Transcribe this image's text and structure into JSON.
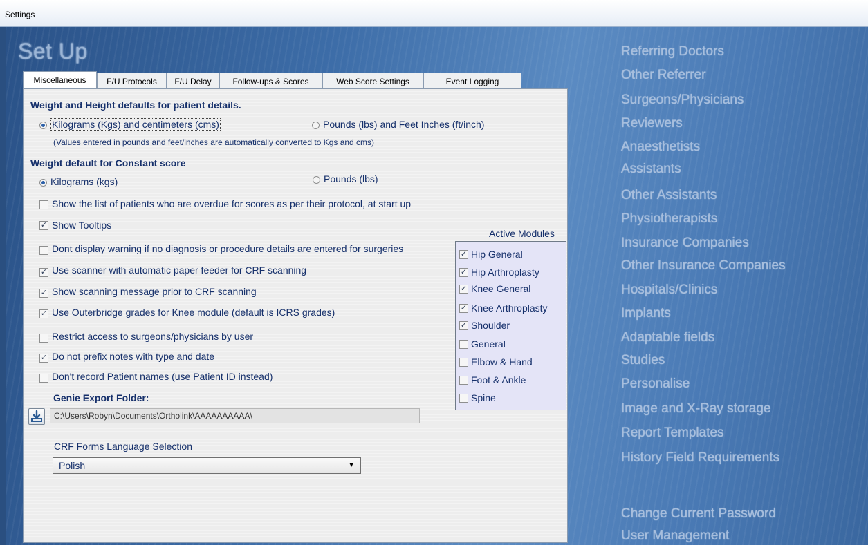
{
  "window": {
    "title": "Settings"
  },
  "page_title": "Set Up",
  "tabs": [
    {
      "label": "Miscellaneous",
      "active": true
    },
    {
      "label": "F/U Protocols"
    },
    {
      "label": "F/U Delay"
    },
    {
      "label": "Follow-ups & Scores"
    },
    {
      "label": "Web Score Settings"
    },
    {
      "label": "Event Logging"
    }
  ],
  "misc": {
    "weight_height_heading": "Weight and Height defaults for patient details.",
    "wh_option_metric": "Kilograms (Kgs)  and  centimeters (cms)",
    "wh_option_imperial": "Pounds (lbs)  and  Feet Inches (ft/inch)",
    "wh_note": "(Values entered in pounds and feet/inches are automatically converted to Kgs and cms)",
    "constant_heading": "Weight default for Constant score",
    "constant_option_kg": "Kilograms (kgs)",
    "constant_option_lbs": "Pounds (lbs)",
    "options": [
      {
        "label": "Show the list of patients who are overdue for scores as per their protocol, at start up",
        "checked": false
      },
      {
        "label": "Show Tooltips",
        "checked": true
      },
      {
        "label": "Dont display warning if no diagnosis or procedure details are entered for surgeries",
        "checked": false
      },
      {
        "label": "Use scanner with automatic paper feeder for CRF scanning",
        "checked": true
      },
      {
        "label": "Show scanning message prior to CRF scanning",
        "checked": true
      },
      {
        "label": "Use Outerbridge grades for Knee module (default is ICRS grades)",
        "checked": true
      },
      {
        "label": "Restrict access to surgeons/physicians by user",
        "checked": false
      },
      {
        "label": "Do not prefix notes with type and date",
        "checked": true
      },
      {
        "label": "Don't record Patient names (use Patient ID instead)",
        "checked": false
      }
    ],
    "genie_label": "Genie Export Folder:",
    "genie_path": "C:\\Users\\Robyn\\Documents\\Ortholink\\AAAAAAAAAA\\",
    "crf_label": "CRF Forms Language Selection",
    "crf_value": "Polish"
  },
  "active_modules": {
    "title": "Active Modules",
    "items": [
      {
        "label": "Hip General",
        "checked": true
      },
      {
        "label": "Hip Arthroplasty",
        "checked": true
      },
      {
        "label": "Knee General",
        "checked": true
      },
      {
        "label": "Knee Arthroplasty",
        "checked": true
      },
      {
        "label": "Shoulder",
        "checked": true
      },
      {
        "label": "General",
        "checked": false
      },
      {
        "label": "Elbow & Hand",
        "checked": false
      },
      {
        "label": "Foot & Ankle",
        "checked": false
      },
      {
        "label": "Spine",
        "checked": false
      }
    ]
  },
  "sidebar": {
    "links": [
      "Referring Doctors",
      "Other Referrer",
      "Surgeons/Physicians",
      "Reviewers",
      "Anaesthetists",
      "Assistants",
      "Other Assistants",
      "Physiotherapists",
      "Insurance Companies",
      "Other Insurance Companies",
      "Hospitals/Clinics",
      "Implants",
      "Adaptable fields",
      "Studies",
      "Personalise",
      "Image and X-Ray storage",
      "Report Templates",
      "History Field Requirements"
    ],
    "bottom_links": [
      "Change Current Password",
      "User Management"
    ]
  },
  "checkmark_glyph": "✓"
}
